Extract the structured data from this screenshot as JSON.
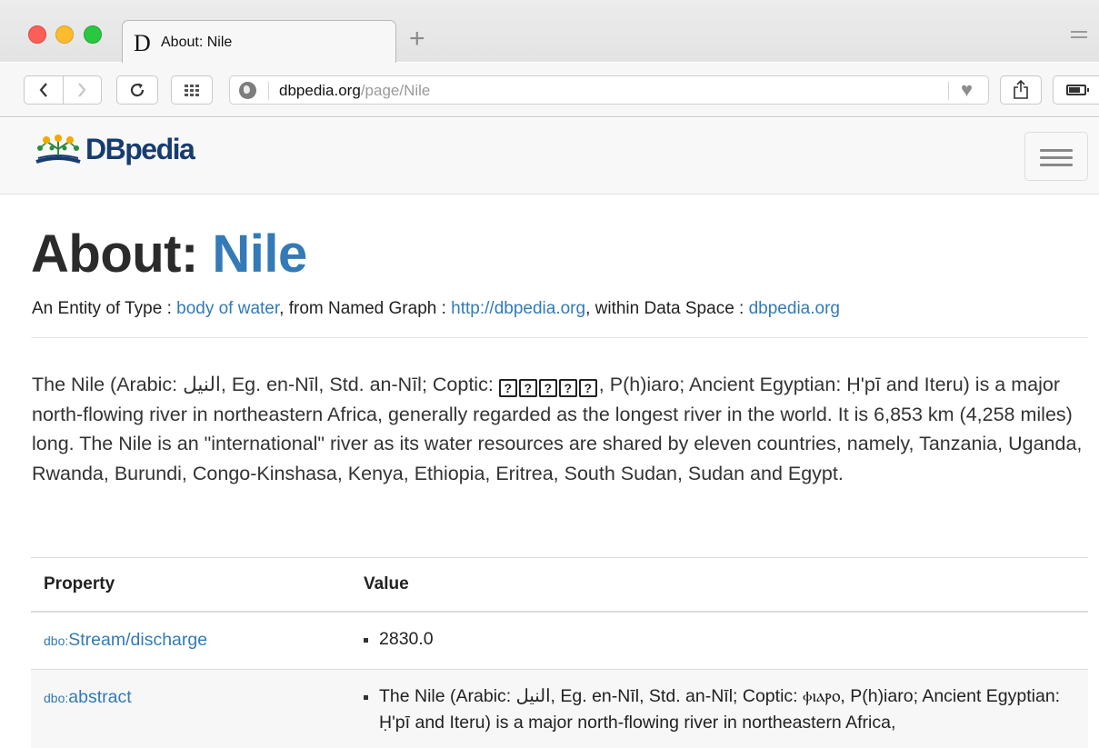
{
  "browser": {
    "tab_favicon": "D",
    "tab_title": "About: Nile",
    "new_tab_label": "+",
    "url_host": "dbpedia.org",
    "url_path": "/page/Nile",
    "icons": [
      "back-icon",
      "forward-icon",
      "reload-icon",
      "apps-grid-icon",
      "globe-icon",
      "heart-icon",
      "share-icon",
      "battery-icon",
      "tab-overflow-icon"
    ]
  },
  "site": {
    "logo_text": "DBpedia"
  },
  "heading": {
    "prefix": "About: ",
    "entity": "Nile"
  },
  "subline": {
    "type_label": "An Entity of Type : ",
    "type_value": "body of water",
    "graph_label": ", from Named Graph : ",
    "graph_value": "http://dbpedia.org",
    "space_label": ", within Data Space : ",
    "space_value": "dbpedia.org"
  },
  "lead": {
    "part1": "The Nile (Arabic: النيل, Eg. en-Nīl, Std. an-Nīl; Coptic: ",
    "missing_glyph": "?",
    "part2": ", P(h)iaro; Ancient Egyptian: Ḥ'pī and Iteru) is a major north-flowing river in northeastern Africa, generally regarded as the longest river in the world. It is 6,853 km (4,258 miles) long. The Nile is an \"international\" river as its water resources are shared by eleven countries, namely, Tanzania, Uganda, Rwanda, Burundi, Congo-Kinshasa, Kenya, Ethiopia, Eritrea, South Sudan, Sudan and Egypt."
  },
  "table": {
    "col_property": "Property",
    "col_value": "Value",
    "rows": [
      {
        "prefix": "dbo:",
        "property": "Stream/discharge",
        "value": "2830.0"
      },
      {
        "prefix": "dbo:",
        "property": "abstract",
        "value": "The Nile (Arabic: النيل, Eg. en-Nīl, Std. an-Nīl; Coptic: ⲫⲓⲁⲣⲟ, P(h)iaro; Ancient Egyptian: Ḥ'pī and Iteru) is a major north-flowing river in northeastern Africa,"
      }
    ]
  }
}
